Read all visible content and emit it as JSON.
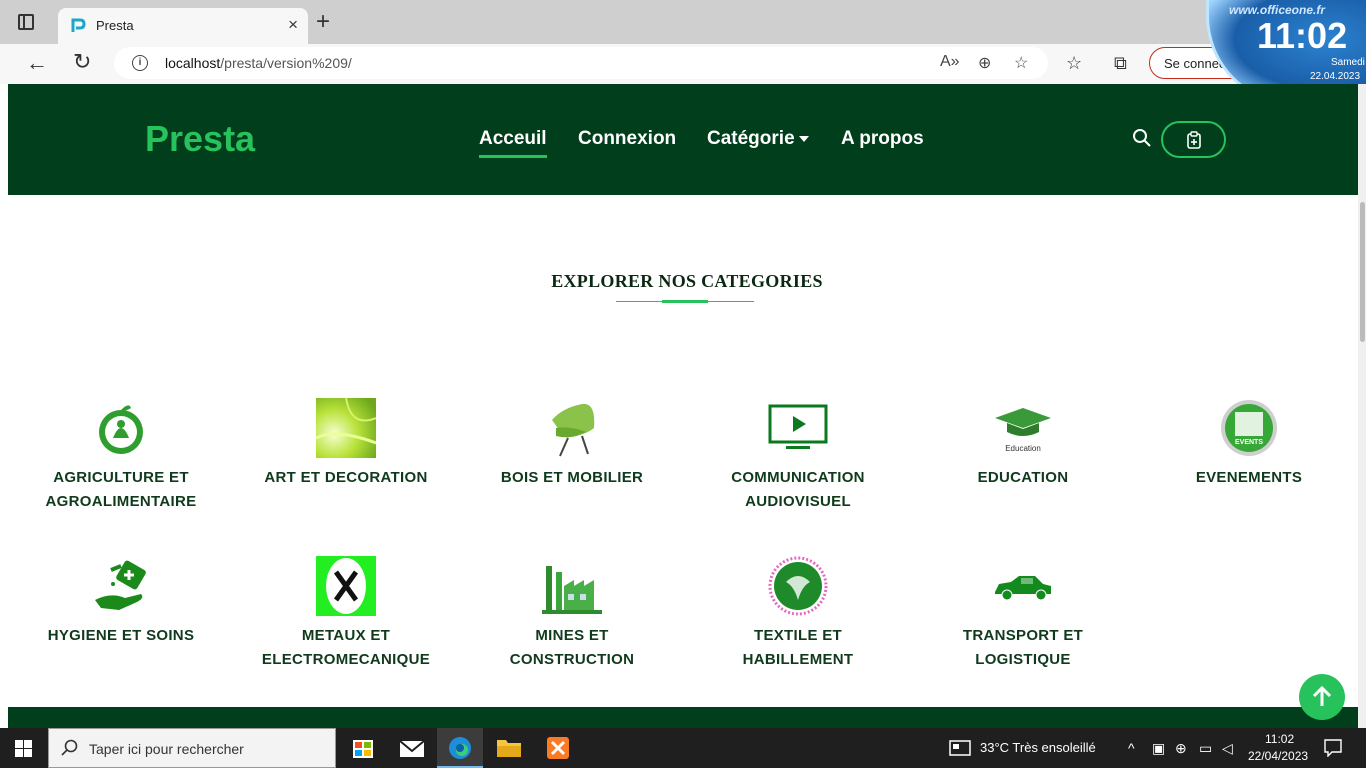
{
  "browser": {
    "tab_title": "Presta",
    "url_host": "localhost",
    "url_path": "/presta/version%209/",
    "signin_label": "Se connecter",
    "new_tab_label": "+",
    "close_tab_label": "×"
  },
  "clock": {
    "site": "www.officeone.fr",
    "time": "11:02",
    "day": "Samedi",
    "date": "22.04.2023"
  },
  "site": {
    "logo": "Presta",
    "nav": {
      "home": "Acceuil",
      "login": "Connexion",
      "category": "Catégorie",
      "about": "A propos"
    },
    "section_title": "EXPLORER NOS CATEGORIES",
    "categories": [
      {
        "line1": "AGRICULTURE ET",
        "line2": "AGROALIMENTAIRE",
        "icon": "agriculture-icon"
      },
      {
        "line1": "ART ET DECORATION",
        "line2": "",
        "icon": "art-decoration-icon"
      },
      {
        "line1": "BOIS ET MOBILIER",
        "line2": "",
        "icon": "chair-icon"
      },
      {
        "line1": "COMMUNICATION",
        "line2": "AUDIOVISUEL",
        "icon": "monitor-play-icon"
      },
      {
        "line1": "EDUCATION",
        "line2": "",
        "icon": "graduation-cap-icon"
      },
      {
        "line1": "EVENEMENTS",
        "line2": "",
        "icon": "events-icon"
      },
      {
        "line1": "HYGIENE ET SOINS",
        "line2": "",
        "icon": "hygiene-icon"
      },
      {
        "line1": "METAUX ET",
        "line2": "ELECTROMECANIQUE",
        "icon": "tools-icon"
      },
      {
        "line1": "MINES ET",
        "line2": "CONSTRUCTION",
        "icon": "factory-icon"
      },
      {
        "line1": "TEXTILE ET",
        "line2": "HABILLEMENT",
        "icon": "textile-icon"
      },
      {
        "line1": "TRANSPORT ET",
        "line2": "LOGISTIQUE",
        "icon": "car-icon"
      }
    ],
    "education_caption": "Education",
    "events_caption": "EVENTS",
    "colors": {
      "brand": "#28c25d",
      "header_bg": "#003e1c",
      "text": "#103a1c"
    }
  },
  "taskbar": {
    "search_placeholder": "Taper ici pour rechercher",
    "weather": "33°C  Très ensoleillé",
    "time": "11:02",
    "date": "22/04/2023"
  }
}
